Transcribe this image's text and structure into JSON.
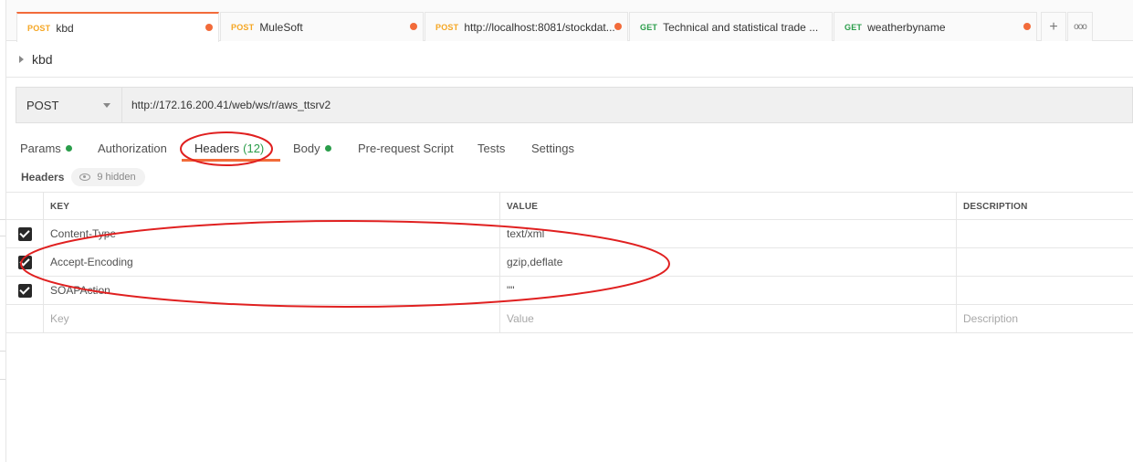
{
  "tabs": [
    {
      "method": "POST",
      "name": "kbd",
      "active": true
    },
    {
      "method": "POST",
      "name": "MuleSoft",
      "active": false
    },
    {
      "method": "POST",
      "name": "http://localhost:8081/stockdat...",
      "active": false
    },
    {
      "method": "GET",
      "name": "Technical and statistical trade ...",
      "active": false
    },
    {
      "method": "GET",
      "name": "weatherbyname",
      "active": false
    }
  ],
  "tab_actions": {
    "new_tab": "+",
    "more": "ooo"
  },
  "request": {
    "name": "kbd",
    "method": "POST",
    "url": "http://172.16.200.41/web/ws/r/aws_ttsrv2"
  },
  "section_tabs": {
    "params": "Params",
    "authorization": "Authorization",
    "headers": "Headers",
    "headers_count": "(12)",
    "body": "Body",
    "prerequest": "Pre-request Script",
    "tests": "Tests",
    "settings": "Settings"
  },
  "headers_section": {
    "label": "Headers",
    "hidden": "9 hidden"
  },
  "table": {
    "columns": {
      "key": "KEY",
      "value": "VALUE",
      "description": "DESCRIPTION"
    },
    "rows": [
      {
        "key": "Content-Type",
        "value": "text/xml",
        "description": ""
      },
      {
        "key": "Accept-Encoding",
        "value": "gzip,deflate",
        "description": ""
      },
      {
        "key": "SOAPAction",
        "value": "\"\"",
        "description": ""
      }
    ],
    "placeholders": {
      "key": "Key",
      "value": "Value",
      "description": "Description"
    }
  },
  "colors": {
    "accent": "#f26b3a",
    "post": "#f5a623",
    "get": "#2a9d4a",
    "annotation": "#e02020"
  }
}
